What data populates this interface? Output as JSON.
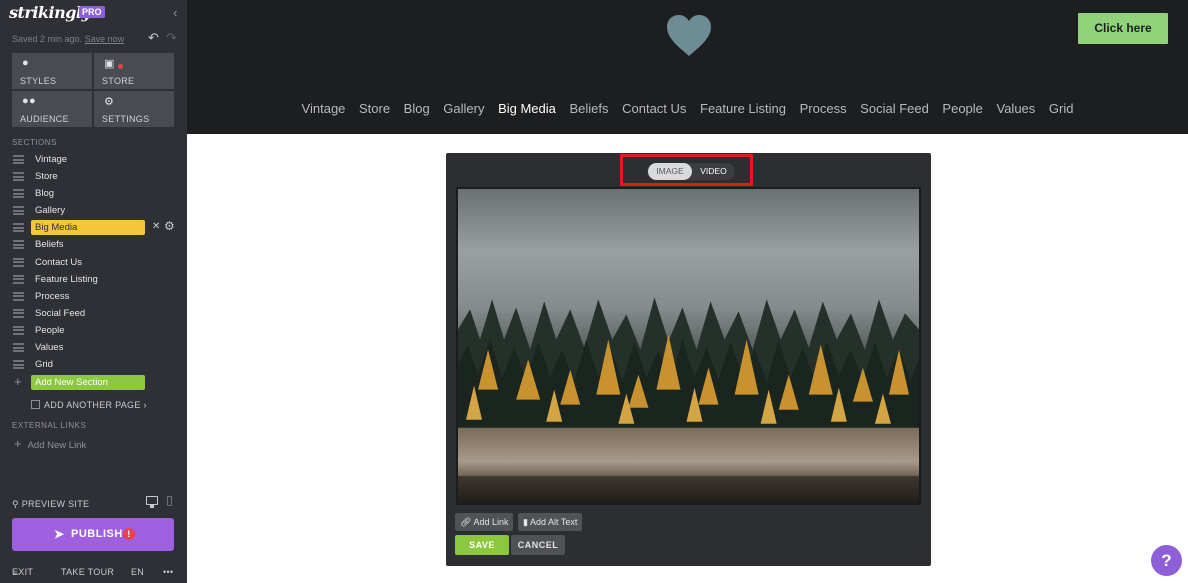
{
  "sidebar": {
    "logo": "strikingly",
    "badge": "PRO",
    "saved_text": "Saved 2 min ago.",
    "save_now": "Save now",
    "tiles": [
      {
        "label": "STYLES",
        "icon": "palette-icon"
      },
      {
        "label": "STORE",
        "icon": "shopping-bag-icon"
      },
      {
        "label": "AUDIENCE",
        "icon": "people-icon"
      },
      {
        "label": "SETTINGS",
        "icon": "gear-icon"
      }
    ],
    "sections_heading": "SECTIONS",
    "sections": [
      "Vintage",
      "Store",
      "Blog",
      "Gallery",
      "Big Media",
      "Beliefs",
      "Contact Us",
      "Feature Listing",
      "Process",
      "Social Feed",
      "People",
      "Values",
      "Grid"
    ],
    "active_section": "Big Media",
    "add_section": "Add New Section",
    "add_page": "ADD ANOTHER PAGE",
    "external_heading": "EXTERNAL LINKS",
    "add_link": "Add New Link",
    "preview": "PREVIEW SITE",
    "publish": "PUBLISH",
    "publish_alert": "!",
    "exit": "EXIT",
    "tour": "TAKE TOUR",
    "lang": "EN",
    "more": "•••"
  },
  "site": {
    "cta": "Click here",
    "nav": [
      "Vintage",
      "Store",
      "Blog",
      "Gallery",
      "Big Media",
      "Beliefs",
      "Contact Us",
      "Feature Listing",
      "Process",
      "Social Feed",
      "People",
      "Values",
      "Grid"
    ],
    "current_nav": "Big Media"
  },
  "editor": {
    "tab_image": "IMAGE",
    "tab_video": "VIDEO",
    "selected_tab": "IMAGE",
    "add_link": "Add Link",
    "add_alt": "Add Alt Text",
    "save": "SAVE",
    "cancel": "CANCEL"
  },
  "help": "?",
  "colors": {
    "sidebar_bg": "#2f3035",
    "active_section": "#f3c63b",
    "add_section": "#8dc63f",
    "publish": "#9e5fe0",
    "cta": "#8fd27a",
    "highlight": "#e31a1a"
  }
}
